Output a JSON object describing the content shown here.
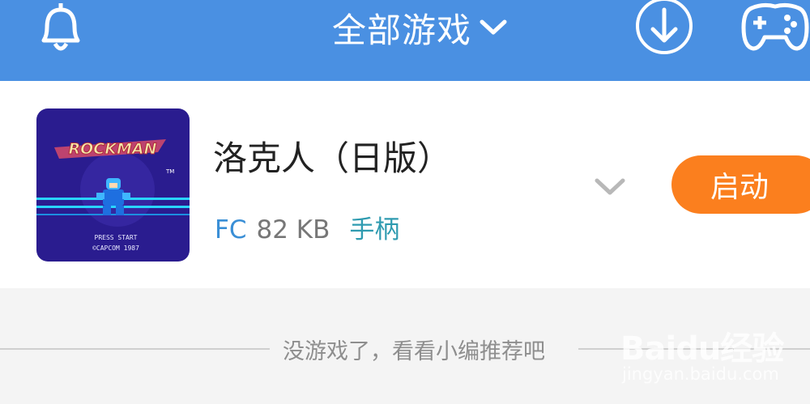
{
  "header": {
    "title": "全部游戏",
    "icons": [
      "bell-icon",
      "chevron-down-icon",
      "download-icon",
      "gamepad-icon"
    ]
  },
  "game": {
    "name": "洛克人（日版）",
    "platform": "FC",
    "size": "82 KB",
    "controller": "手柄",
    "launch_label": "启动",
    "thumbnail": {
      "logo_text": "ROCKMAN",
      "tm": "TM",
      "line1": "PRESS START",
      "line2": "©CAPCOM 1987"
    }
  },
  "footer": {
    "hint": "没游戏了，看看小编推荐吧"
  },
  "watermark": {
    "logo": "Baidu经验",
    "site": "jingyan.baidu.com"
  },
  "colors": {
    "header_bg": "#4a90e2",
    "launch_bg": "#fb7f1e",
    "platform_text": "#3a8fd6",
    "controller_text": "#2f9bb0"
  }
}
